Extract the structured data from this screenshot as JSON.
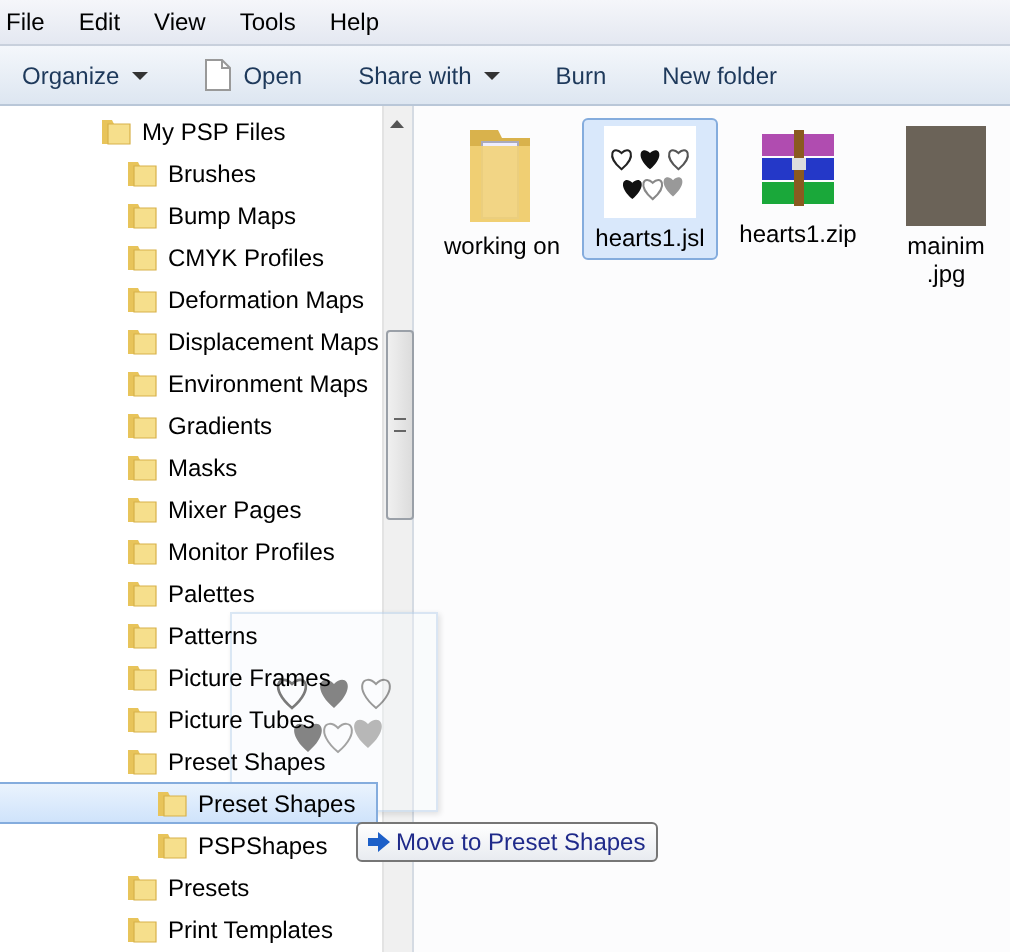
{
  "menu": [
    "File",
    "Edit",
    "View",
    "Tools",
    "Help"
  ],
  "toolbar": [
    {
      "label": "Organize",
      "kind": "dropdown"
    },
    {
      "label": "Open",
      "kind": "document"
    },
    {
      "label": "Share with",
      "kind": "dropdown"
    },
    {
      "label": "Burn",
      "kind": "plain"
    },
    {
      "label": "New folder",
      "kind": "plain"
    }
  ],
  "tree": [
    {
      "label": "My PSP Files",
      "selected": false,
      "children": [
        {
          "label": "Brushes",
          "selected": false
        },
        {
          "label": "Bump Maps",
          "selected": false
        },
        {
          "label": "CMYK Profiles",
          "selected": false
        },
        {
          "label": "Deformation Maps",
          "selected": false
        },
        {
          "label": "Displacement Maps",
          "selected": false
        },
        {
          "label": "Environment Maps",
          "selected": false
        },
        {
          "label": "Gradients",
          "selected": false
        },
        {
          "label": "Masks",
          "selected": false
        },
        {
          "label": "Mixer Pages",
          "selected": false
        },
        {
          "label": "Monitor Profiles",
          "selected": false
        },
        {
          "label": "Palettes",
          "selected": false
        },
        {
          "label": "Patterns",
          "selected": false
        },
        {
          "label": "Picture Frames",
          "selected": false
        },
        {
          "label": "Picture Tubes",
          "selected": false
        },
        {
          "label": "Preset Shapes",
          "selected": false,
          "children": [
            {
              "label": "Preset Shapes",
              "selected": true
            },
            {
              "label": "PSPShapes",
              "selected": false
            }
          ]
        },
        {
          "label": "Presets",
          "selected": false
        },
        {
          "label": "Print Templates",
          "selected": false
        }
      ]
    }
  ],
  "files": [
    {
      "name": "working on",
      "kind": "folder",
      "selected": false
    },
    {
      "name": "hearts1.jsl",
      "kind": "hearts",
      "selected": true
    },
    {
      "name": "hearts1.zip",
      "kind": "archive",
      "selected": false
    },
    {
      "name": "mainim\n.jpg",
      "kind": "photo",
      "selected": false
    }
  ],
  "drag_tooltip": "Move to Preset Shapes"
}
